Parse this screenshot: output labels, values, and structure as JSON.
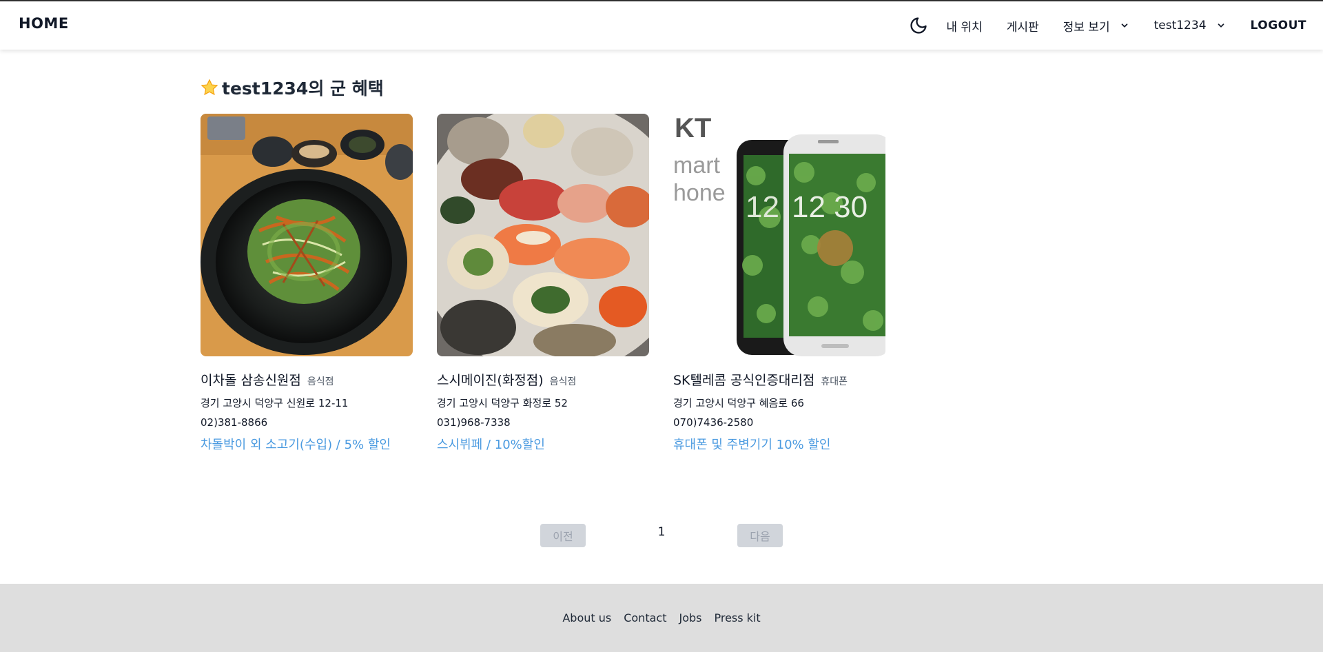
{
  "header": {
    "home": "HOME",
    "theme_icon": "moon-icon",
    "nav": {
      "my_location": "내 위치",
      "board": "게시판",
      "info": "정보 보기",
      "user": "test1234",
      "logout": "LOGOUT"
    }
  },
  "main": {
    "title": "test1234의 군 혜택",
    "title_icon": "star-icon",
    "cards": [
      {
        "name": "이차돌 삼송신원점",
        "category": "음식점",
        "address": "경기 고양시 덕양구 신원로 12-11",
        "phone": "02)381-8866",
        "benefit": "차돌박이 외 소고기(수입) / 5% 할인",
        "image_text": []
      },
      {
        "name": "스시메이진(화정점)",
        "category": "음식점",
        "address": "경기 고양시 덕양구 화정로 52",
        "phone": "031)968-7338",
        "benefit": "스시뷔페 / 10%할인",
        "image_text": []
      },
      {
        "name": "SK텔레콤 공식인증대리점",
        "category": "휴대폰",
        "address": "경기 고양시 덕양구 혜음로 66",
        "phone": "070)7436-2580",
        "benefit": "휴대폰 및 주변기기 10% 할인",
        "image_text": [
          "KT",
          "mart",
          "hone",
          "12",
          "12 30"
        ]
      }
    ]
  },
  "pagination": {
    "prev": "이전",
    "current": "1",
    "next": "다음"
  },
  "footer": {
    "links": [
      "About us",
      "Contact",
      "Jobs",
      "Press kit"
    ]
  },
  "colors": {
    "benefit": "#4a9ae0",
    "footer_bg": "#dedede",
    "pager_btn": "#d1d5db"
  }
}
